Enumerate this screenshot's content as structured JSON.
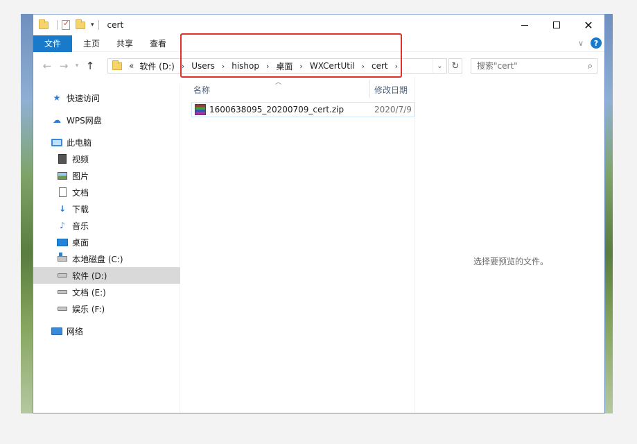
{
  "window": {
    "title": "cert",
    "controls": {
      "minimize": "—",
      "maximize": "□",
      "close": "✕"
    }
  },
  "ribbon": {
    "tabs": [
      "文件",
      "主页",
      "共享",
      "查看"
    ]
  },
  "navigation": {
    "back": "←",
    "forward": "→",
    "recent": "⌄",
    "up": "↑",
    "address_overflow": "«",
    "breadcrumb": [
      "软件 (D:)",
      "Users",
      "hishop",
      "桌面",
      "WXCertUtil",
      "cert"
    ],
    "search_placeholder": "搜索\"cert\""
  },
  "sidebar": {
    "items": [
      {
        "label": "快速访问",
        "icon": "star-icon"
      },
      {
        "label": "WPS网盘",
        "icon": "cloud-icon"
      },
      {
        "label": "此电脑",
        "icon": "computer-icon"
      },
      {
        "label": "视频",
        "icon": "video-icon"
      },
      {
        "label": "图片",
        "icon": "picture-icon"
      },
      {
        "label": "文档",
        "icon": "document-icon"
      },
      {
        "label": "下载",
        "icon": "download-icon"
      },
      {
        "label": "音乐",
        "icon": "music-icon"
      },
      {
        "label": "桌面",
        "icon": "desktop-icon"
      },
      {
        "label": "本地磁盘 (C:)",
        "icon": "drive-icon"
      },
      {
        "label": "软件 (D:)",
        "icon": "drive-icon",
        "selected": true
      },
      {
        "label": "文档 (E:)",
        "icon": "drive-icon"
      },
      {
        "label": "娱乐 (F:)",
        "icon": "drive-icon"
      },
      {
        "label": "网络",
        "icon": "network-icon"
      }
    ]
  },
  "filelist": {
    "columns": [
      "名称",
      "修改日期"
    ],
    "files": [
      {
        "name": "1600638095_20200709_cert.zip",
        "date": "2020/7/9",
        "icon": "winrar-archive-icon"
      }
    ]
  },
  "preview": {
    "text": "选择要预览的文件。"
  },
  "colors": {
    "accent": "#1979ca",
    "annotation": "#e0302c",
    "selection": "#d9d9d9"
  }
}
